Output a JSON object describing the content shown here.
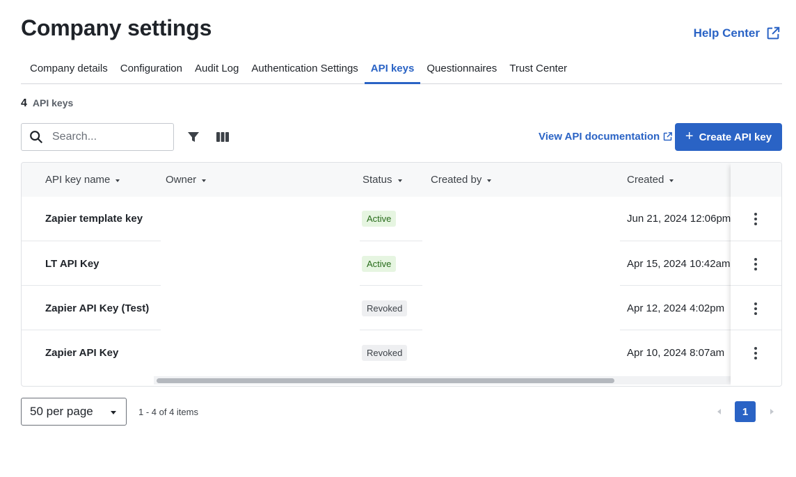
{
  "page": {
    "title": "Company settings",
    "help_link": "Help Center"
  },
  "tabs": [
    {
      "label": "Company details",
      "active": false
    },
    {
      "label": "Configuration",
      "active": false
    },
    {
      "label": "Audit Log",
      "active": false
    },
    {
      "label": "Authentication Settings",
      "active": false
    },
    {
      "label": "API keys",
      "active": true
    },
    {
      "label": "Questionnaires",
      "active": false
    },
    {
      "label": "Trust Center",
      "active": false
    }
  ],
  "summary": {
    "count": "4",
    "count_label": "API keys"
  },
  "toolbar": {
    "search_placeholder": "Search...",
    "search_value": "",
    "filter_icon": "filter-icon",
    "columns_icon": "columns-icon",
    "doc_link": "View API documentation",
    "create_button": "Create API key"
  },
  "table": {
    "columns": [
      "API key name",
      "Owner",
      "Status",
      "Created by",
      "Created"
    ],
    "rows": [
      {
        "name": "Zapier template key",
        "owner": "",
        "status": "Active",
        "created_by": "",
        "created": "Jun 21, 2024 12:06pm"
      },
      {
        "name": "LT API Key",
        "owner": "",
        "status": "Active",
        "created_by": "",
        "created": "Apr 15, 2024 10:42am"
      },
      {
        "name": "Zapier API Key (Test)",
        "owner": "",
        "status": "Revoked",
        "created_by": "",
        "created": "Apr 12, 2024 4:02pm"
      },
      {
        "name": "Zapier API Key",
        "owner": "",
        "status": "Revoked",
        "created_by": "",
        "created": "Apr 10, 2024 8:07am"
      }
    ]
  },
  "pagination": {
    "per_page": "50 per page",
    "range": "1 - 4 of 4 items",
    "current_page": "1"
  },
  "colors": {
    "accent": "#2a63c5",
    "active_badge_bg": "#e6f5e1",
    "active_badge_text": "#276b1a",
    "revoked_badge_bg": "#eeeff1"
  }
}
